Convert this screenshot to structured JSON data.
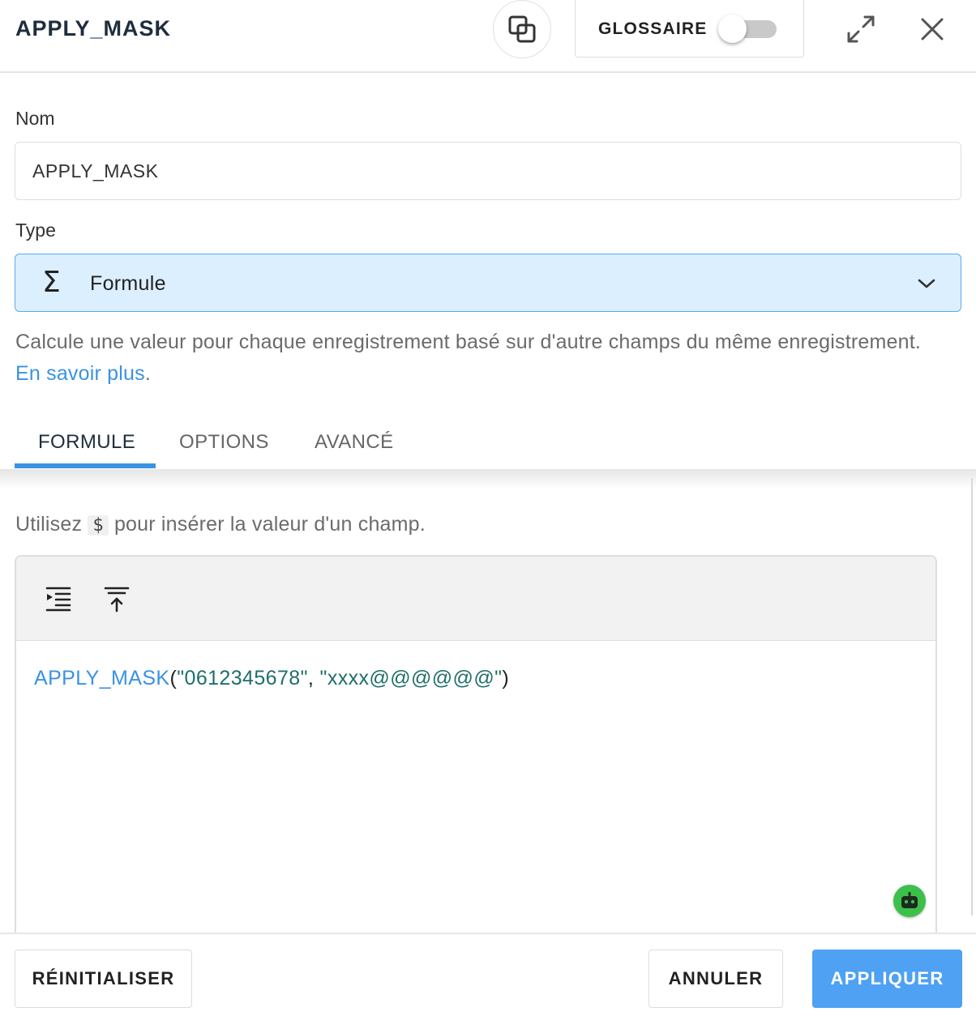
{
  "header": {
    "title": "APPLY_MASK",
    "glossary_label": "GLOSSAIRE",
    "glossary_enabled": false
  },
  "form": {
    "name_label": "Nom",
    "name_value": "APPLY_MASK",
    "type_label": "Type",
    "type_value": "Formule",
    "type_icon": "sigma-icon",
    "description": "Calcule une valeur pour chaque enregistrement basé sur d'autre champs du même enregistrement.",
    "learn_more": "En savoir plus",
    "period": "."
  },
  "tabs": [
    {
      "label": "FORMULE",
      "active": true
    },
    {
      "label": "OPTIONS",
      "active": false
    },
    {
      "label": "AVANCÉ",
      "active": false
    }
  ],
  "formula": {
    "hint_before": "Utilisez",
    "hint_chip": "$",
    "hint_after": "pour insérer la valeur d'un champ.",
    "tools": [
      "indent-icon",
      "move-to-top-icon"
    ],
    "code": {
      "function": "APPLY_MASK",
      "open": "(",
      "arg1": "\"0612345678\"",
      "sep": ", ",
      "arg2": "\"xxxx@@@@@@\"",
      "close": ")"
    }
  },
  "footer": {
    "reset_label": "RÉINITIALISER",
    "cancel_label": "ANNULER",
    "apply_label": "APPLIQUER"
  },
  "colors": {
    "accent": "#3a92e3",
    "primary_button": "#4ea1f3",
    "select_bg": "#dcefff",
    "string": "#1e6f6a",
    "assistant": "#3cc04a"
  }
}
